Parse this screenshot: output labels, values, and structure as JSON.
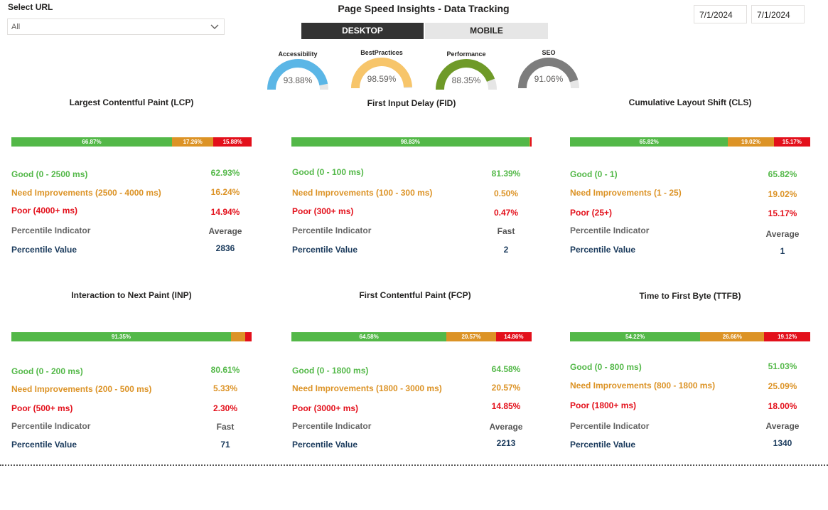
{
  "filter": {
    "label": "Select URL",
    "value": "All"
  },
  "title": "Page Speed Insights - Data Tracking",
  "dates": {
    "start": "7/1/2024",
    "end": "7/1/2024"
  },
  "tabs": {
    "desktop": "DESKTOP",
    "mobile": "MOBILE",
    "active": "desktop"
  },
  "gauges": [
    {
      "label": "Accessibility",
      "value": "93.88%",
      "fraction": 0.9388,
      "color": "#5bb6e6"
    },
    {
      "label": "BestPractices",
      "value": "98.59%",
      "fraction": 0.9859,
      "color": "#f7c56a"
    },
    {
      "label": "Performance",
      "value": "88.35%",
      "fraction": 0.8835,
      "color": "#6f9a28"
    },
    {
      "label": "SEO",
      "value": "91.06%",
      "fraction": 0.9106,
      "color": "#7d7d7d"
    }
  ],
  "colors": {
    "good": "#53b848",
    "needs_improvement": "#dc9326",
    "poor": "#e3101b",
    "gauge_track": "#e6e6e6"
  },
  "metrics": [
    {
      "title": "Largest Contentful Paint (LCP)",
      "bar": {
        "good": 66.87,
        "ni": 17.26,
        "poor": 15.88,
        "good_label": "66.87%",
        "ni_label": "17.26%",
        "poor_label": "15.88%"
      },
      "good_label": "Good (0 - 2500 ms)",
      "good_value": "62.93%",
      "ni_label": "Need Improvements (2500 - 4000 ms)",
      "ni_value": "16.24%",
      "poor_label": "Poor (4000+ ms)",
      "poor_value": "14.94%",
      "indicator_label": "Percentile Indicator",
      "indicator_value": "Average",
      "pvalue_label": "Percentile Value",
      "pvalue_value": "2836"
    },
    {
      "title": "First Input Delay (FID)",
      "bar": {
        "good": 98.83,
        "ni": 0.5,
        "poor": 0.47,
        "good_label": "98.83%",
        "ni_label": "",
        "poor_label": ""
      },
      "good_label": "Good (0 - 100 ms)",
      "good_value": "81.39%",
      "ni_label": "Need Improvements (100 - 300 ms)",
      "ni_value": "0.50%",
      "poor_label": "Poor (300+ ms)",
      "poor_value": "0.47%",
      "indicator_label": "Percentile Indicator",
      "indicator_value": "Fast",
      "pvalue_label": "Percentile Value",
      "pvalue_value": "2"
    },
    {
      "title": "Cumulative Layout Shift (CLS)",
      "bar": {
        "good": 65.82,
        "ni": 19.02,
        "poor": 15.17,
        "good_label": "65.82%",
        "ni_label": "19.02%",
        "poor_label": "15.17%"
      },
      "good_label": "Good (0 - 1)",
      "good_value": "65.82%",
      "ni_label": "Need Improvements (1 - 25)",
      "ni_value": "19.02%",
      "poor_label": "Poor (25+)",
      "poor_value": "15.17%",
      "indicator_label": "Percentile Indicator",
      "indicator_value": "Average",
      "pvalue_label": "Percentile Value",
      "pvalue_value": "1"
    },
    {
      "title": "Interaction to Next Paint (INP)",
      "bar": {
        "good": 91.35,
        "ni": 6.0,
        "poor": 2.6,
        "good_label": "91.35%",
        "ni_label": "",
        "poor_label": ""
      },
      "good_label": "Good (0 - 200 ms)",
      "good_value": "80.61%",
      "ni_label": "Need Improvements (200 - 500 ms)",
      "ni_value": "5.33%",
      "poor_label": "Poor (500+ ms)",
      "poor_value": "2.30%",
      "indicator_label": "Percentile Indicator",
      "indicator_value": "Fast",
      "pvalue_label": "Percentile Value",
      "pvalue_value": "71"
    },
    {
      "title": "First Contentful Paint (FCP)",
      "bar": {
        "good": 64.58,
        "ni": 20.57,
        "poor": 14.86,
        "good_label": "64.58%",
        "ni_label": "20.57%",
        "poor_label": "14.86%"
      },
      "good_label": "Good (0 - 1800 ms)",
      "good_value": "64.58%",
      "ni_label": "Need Improvements (1800 - 3000 ms)",
      "ni_value": "20.57%",
      "poor_label": "Poor (3000+ ms)",
      "poor_value": "14.85%",
      "indicator_label": "Percentile Indicator",
      "indicator_value": "Average",
      "pvalue_label": "Percentile Value",
      "pvalue_value": "2213"
    },
    {
      "title": "Time to First Byte (TTFB)",
      "bar": {
        "good": 54.22,
        "ni": 26.66,
        "poor": 19.12,
        "good_label": "54.22%",
        "ni_label": "26.66%",
        "poor_label": "19.12%"
      },
      "good_label": "Good (0 - 800 ms)",
      "good_value": "51.03%",
      "ni_label": "Need Improvements (800 - 1800 ms)",
      "ni_value": "25.09%",
      "poor_label": "Poor (1800+ ms)",
      "poor_value": "18.00%",
      "indicator_label": "Percentile Indicator",
      "indicator_value": "Average",
      "pvalue_label": "Percentile Value",
      "pvalue_value": "1340"
    }
  ]
}
